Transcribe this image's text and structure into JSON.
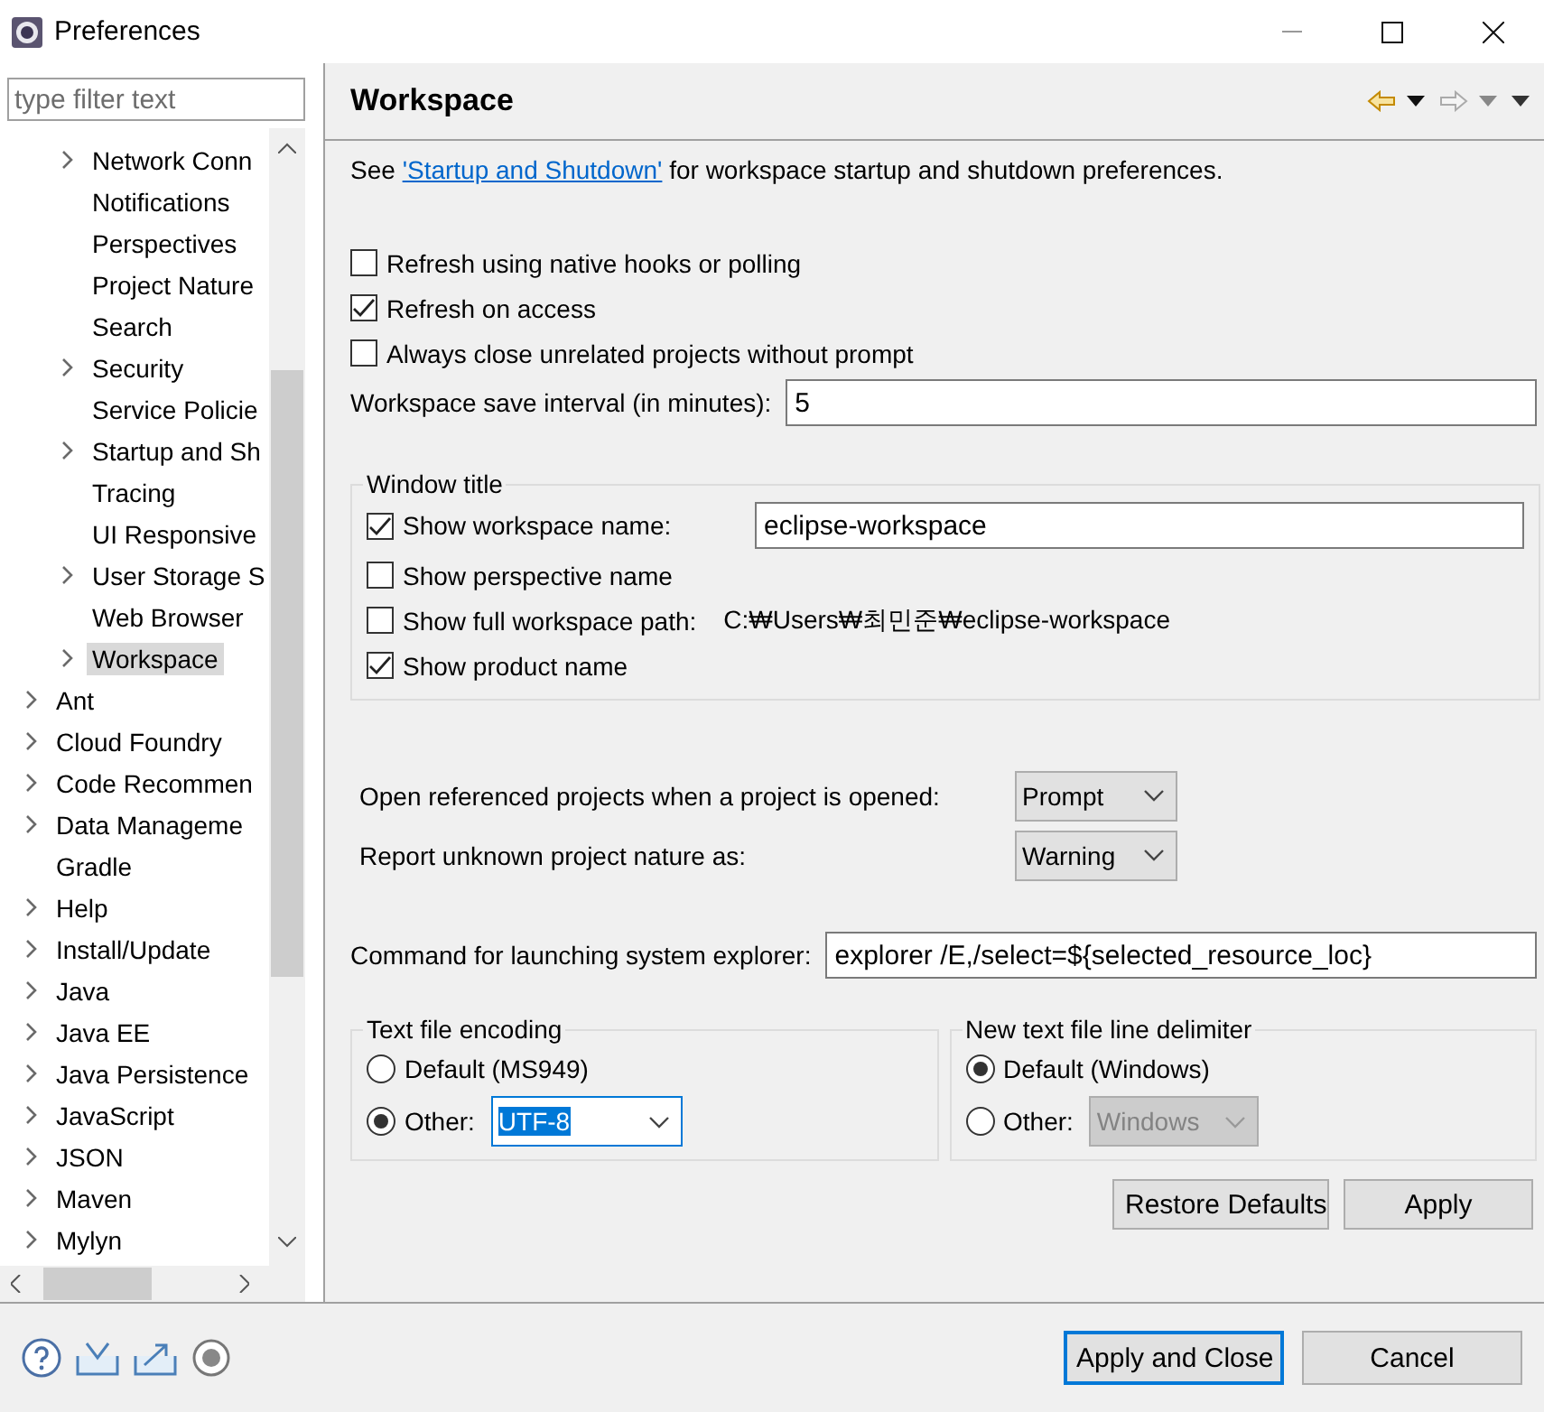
{
  "window": {
    "title": "Preferences"
  },
  "filter": {
    "placeholder": "type filter text"
  },
  "tree": [
    {
      "children": [
        {
          "label": "Network Conn",
          "expandable": true,
          "selected": false
        },
        {
          "label": "Notifications",
          "expandable": false,
          "selected": false
        },
        {
          "label": "Perspectives",
          "expandable": false,
          "selected": false
        },
        {
          "label": "Project Nature",
          "expandable": false,
          "selected": false
        },
        {
          "label": "Search",
          "expandable": false,
          "selected": false
        },
        {
          "label": "Security",
          "expandable": true,
          "selected": false
        },
        {
          "label": "Service Policie",
          "expandable": false,
          "selected": false
        },
        {
          "label": "Startup and Sh",
          "expandable": true,
          "selected": false
        },
        {
          "label": "Tracing",
          "expandable": false,
          "selected": false
        },
        {
          "label": "UI Responsive",
          "expandable": false,
          "selected": false
        },
        {
          "label": "User Storage S",
          "expandable": true,
          "selected": false
        },
        {
          "label": "Web Browser",
          "expandable": false,
          "selected": false
        },
        {
          "label": "Workspace",
          "expandable": true,
          "selected": true
        }
      ]
    },
    {
      "label": "Ant",
      "expandable": true,
      "selected": false
    },
    {
      "label": "Cloud Foundry",
      "expandable": true,
      "selected": false
    },
    {
      "label": "Code Recommen",
      "expandable": true,
      "selected": false
    },
    {
      "label": "Data Manageme",
      "expandable": true,
      "selected": false
    },
    {
      "label": "Gradle",
      "expandable": false,
      "selected": false
    },
    {
      "label": "Help",
      "expandable": true,
      "selected": false
    },
    {
      "label": "Install/Update",
      "expandable": true,
      "selected": false
    },
    {
      "label": "Java",
      "expandable": true,
      "selected": false
    },
    {
      "label": "Java EE",
      "expandable": true,
      "selected": false
    },
    {
      "label": "Java Persistence",
      "expandable": true,
      "selected": false
    },
    {
      "label": "JavaScript",
      "expandable": true,
      "selected": false
    },
    {
      "label": "JSON",
      "expandable": true,
      "selected": false
    },
    {
      "label": "Maven",
      "expandable": true,
      "selected": false
    },
    {
      "label": "Mylyn",
      "expandable": true,
      "selected": false
    }
  ],
  "page": {
    "title": "Workspace",
    "intro": {
      "before": "See",
      "link": "'Startup and Shutdown'",
      "after": "for workspace startup and shutdown preferences."
    },
    "options": [
      {
        "label": "Refresh using native hooks or polling",
        "checked": false
      },
      {
        "label": "Refresh on access",
        "checked": true
      },
      {
        "label": "Always close unrelated projects without prompt",
        "checked": false
      }
    ],
    "save_interval": {
      "label": "Workspace save interval (in minutes):",
      "value": "5"
    },
    "window_title": {
      "legend": "Window title",
      "items": [
        {
          "kind": "input",
          "label": "Show workspace name:",
          "checked": true,
          "value": "eclipse-workspace"
        },
        {
          "kind": "plain",
          "label": "Show perspective name",
          "checked": false
        },
        {
          "kind": "path",
          "label": "Show full workspace path:",
          "checked": false,
          "value": "C:₩Users₩최민준₩eclipse-workspace"
        },
        {
          "kind": "plain",
          "label": "Show product name",
          "checked": true
        }
      ]
    },
    "selects": [
      {
        "label": "Open referenced projects when a project is opened:",
        "value": "Prompt"
      },
      {
        "label": "Report unknown project nature as:",
        "value": "Warning"
      }
    ],
    "explorer": {
      "label": "Command for launching system explorer:",
      "value": "explorer /E,/select=${selected_resource_loc}"
    },
    "encoding": {
      "legend": "Text file encoding",
      "default_label": "Default (MS949)",
      "default_selected": false,
      "other_label": "Other:",
      "other_selected": true,
      "other_value": "UTF-8",
      "other_disabled": false
    },
    "delimiter": {
      "legend": "New text file line delimiter",
      "default_label": "Default (Windows)",
      "default_selected": true,
      "other_label": "Other:",
      "other_selected": false,
      "other_value": "Windows",
      "other_disabled": true
    },
    "buttons": [
      "Restore Defaults",
      "Apply"
    ]
  },
  "footer": {
    "buttons": [
      "Apply and Close",
      "Cancel"
    ]
  }
}
